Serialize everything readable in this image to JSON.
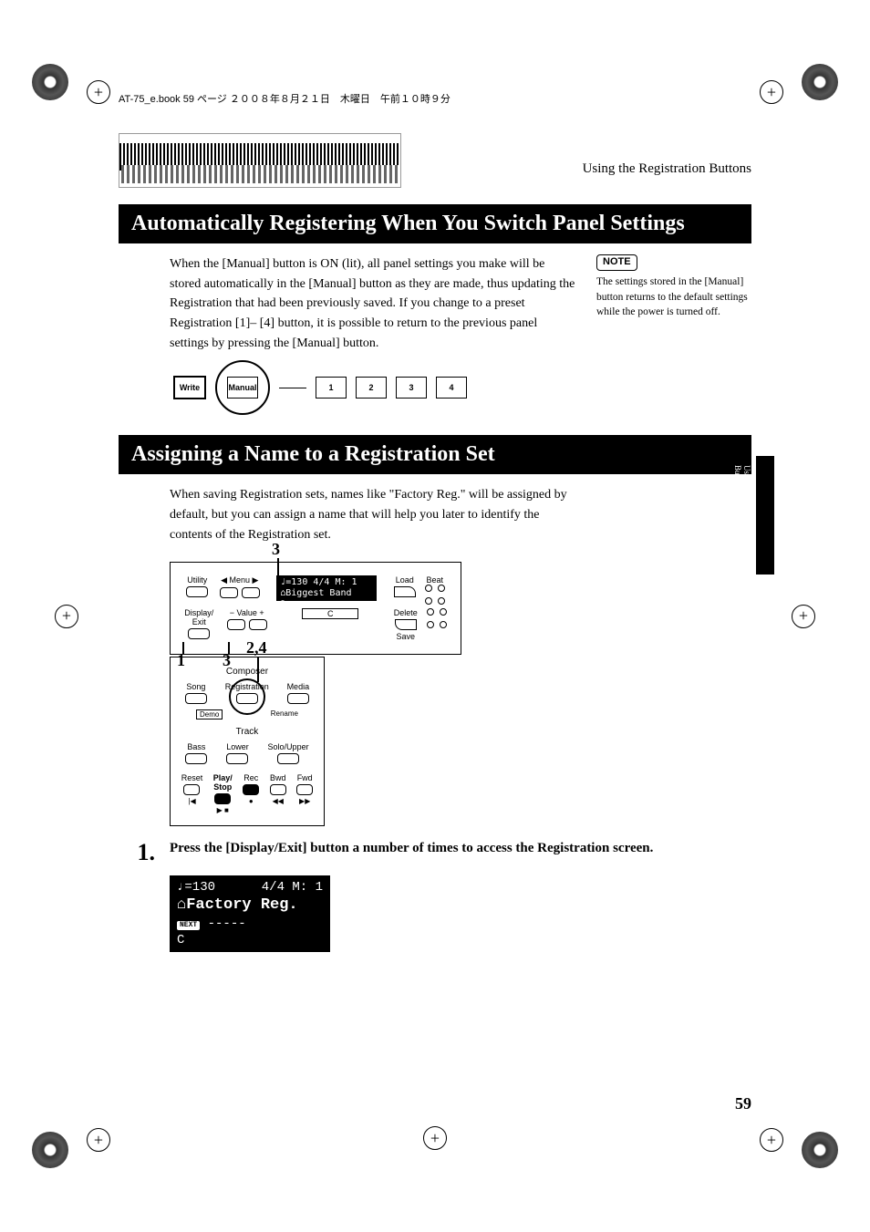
{
  "header_line": "AT-75_e.book 59 ページ ２００８年８月２１日　木曜日　午前１０時９分",
  "section_label": "Using the Registration Buttons",
  "title1": "Automatically Registering When You Switch Panel Settings",
  "para1": "When the [Manual] button is ON (lit), all panel settings you make will be stored automatically in the [Manual] button as they are made, thus updating the Registration that had been previously saved. If you change to a preset Registration [1]– [4] button, it is possible to return to the previous panel settings by pressing the [Manual] button.",
  "note_badge": "NOTE",
  "note1": "The settings stored in the [Manual] button returns to the default settings while the power is turned off.",
  "btn": {
    "write": "Write",
    "manual": "Manual",
    "b1": "1",
    "b2": "2",
    "b3": "3",
    "b4": "4"
  },
  "title2": "Assigning a Name to a Registration Set",
  "para2": "When saving Registration sets, names like \"Factory Reg.\" will be assigned by default, but you can assign a name that will help you later to identify the contents of the Registration set.",
  "diagram1": {
    "c3a": "3",
    "c1": "1",
    "c3b": "3",
    "c24": "2,4",
    "utility": "Utility",
    "menu": "Menu",
    "display_exit": "Display/\nExit",
    "value": "− Value +",
    "lcd_top": "♩=130    4/4 M:  1",
    "lcd_mid": "⌂Biggest Band",
    "lcd_bot": "C",
    "load": "Load",
    "beat": "Beat",
    "delete": "Delete",
    "save": "Save"
  },
  "diagram2": {
    "composer": "Composer",
    "song": "Song",
    "registration": "Registration",
    "media": "Media",
    "demo": "Demo",
    "rename": "Rename",
    "track": "Track",
    "bass": "Bass",
    "lower": "Lower",
    "solo_upper": "Solo/Upper",
    "reset": "Reset",
    "play_stop": "Play/\nStop",
    "rec": "Rec",
    "bwd": "Bwd",
    "fwd": "Fwd"
  },
  "step1_num": "1.",
  "step1_text": "Press the [Display/Exit] button a number of times to access the Registration screen.",
  "screen": {
    "l1_left": "♩=130",
    "l1_right": "4/4  M:   1",
    "l2_icon": "⌂",
    "l2_text": "Factory Reg.",
    "l3_badge": "NEXT",
    "l3_dashes": "-----",
    "l4": "C"
  },
  "side_tab_text": "Using the Registration Buttons",
  "page_num": "59"
}
